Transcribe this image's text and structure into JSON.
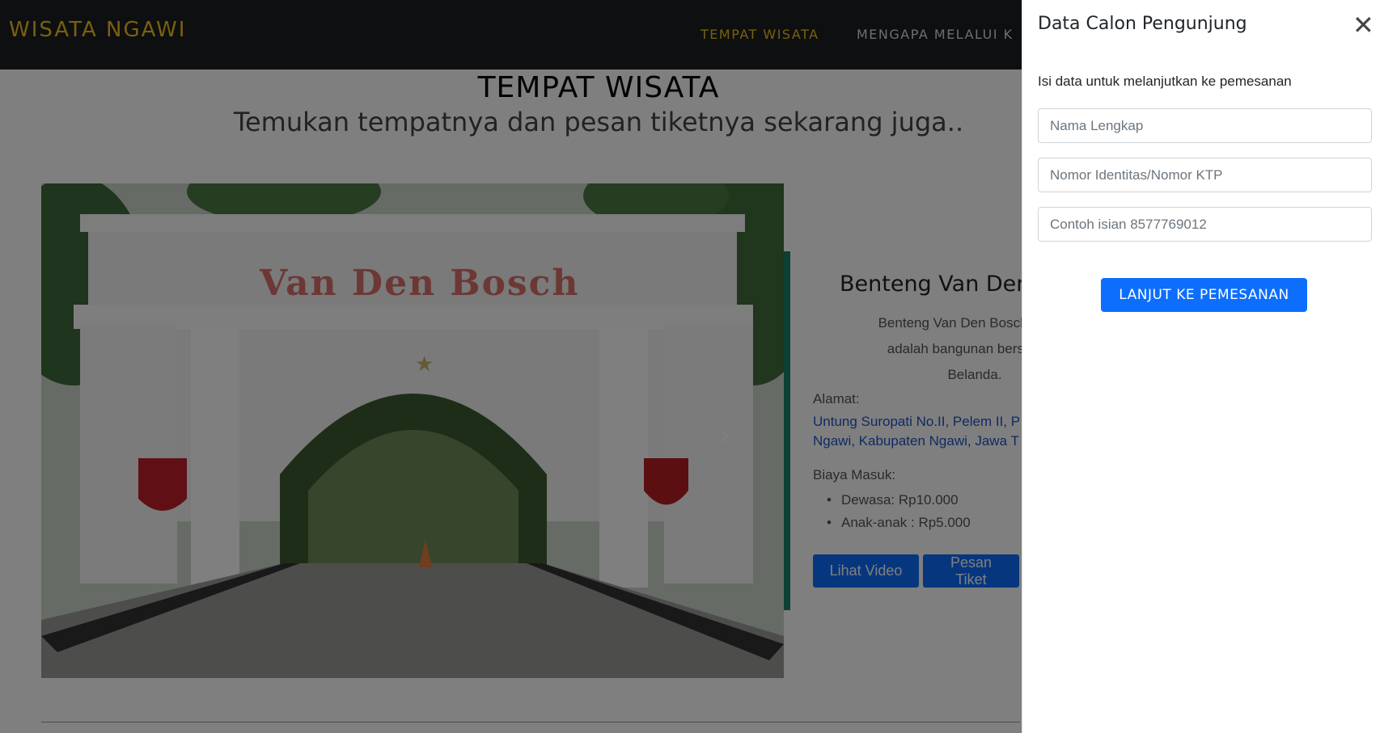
{
  "navbar": {
    "brand": "WISATA NGAWI",
    "links": [
      "TEMPAT WISATA",
      "MENGAPA MELALUI K"
    ],
    "brand_color": "#f0c020",
    "background": "#1d1f20"
  },
  "main": {
    "title": "TEMPAT WISATA",
    "subtitle": "Temukan tempatnya dan pesan tiketnya sekarang juga..",
    "photo_sign": "Van Den Bosch",
    "place": {
      "name": "Benteng Van Den",
      "desc_lines": [
        "Benteng Van Den Bosch atau B",
        "adalah bangunan bersejarah",
        "Belanda."
      ],
      "address_label": "Alamat:",
      "address_lines": [
        "Untung Suropati No.II, Pelem II, P",
        "Ngawi, Kabupaten Ngawi, Jawa T"
      ],
      "price_label": "Biaya Masuk:",
      "prices": [
        "Dewasa: Rp10.000",
        "Anak-anak : Rp5.000"
      ],
      "btn_video": "Lihat Video",
      "btn_ticket": "Pesan Tiket"
    }
  },
  "offcanvas": {
    "title": "Data Calon Pengunjung",
    "info": "Isi data untuk melanjutkan ke pemesanan",
    "fields": [
      {
        "placeholder": "Nama Lengkap"
      },
      {
        "placeholder": "Nomor Identitas/Nomor KTP"
      },
      {
        "placeholder": "Contoh isian 8577769012"
      }
    ],
    "submit": "LANJUT KE PEMESANAN",
    "accent": "#0d6efd"
  }
}
